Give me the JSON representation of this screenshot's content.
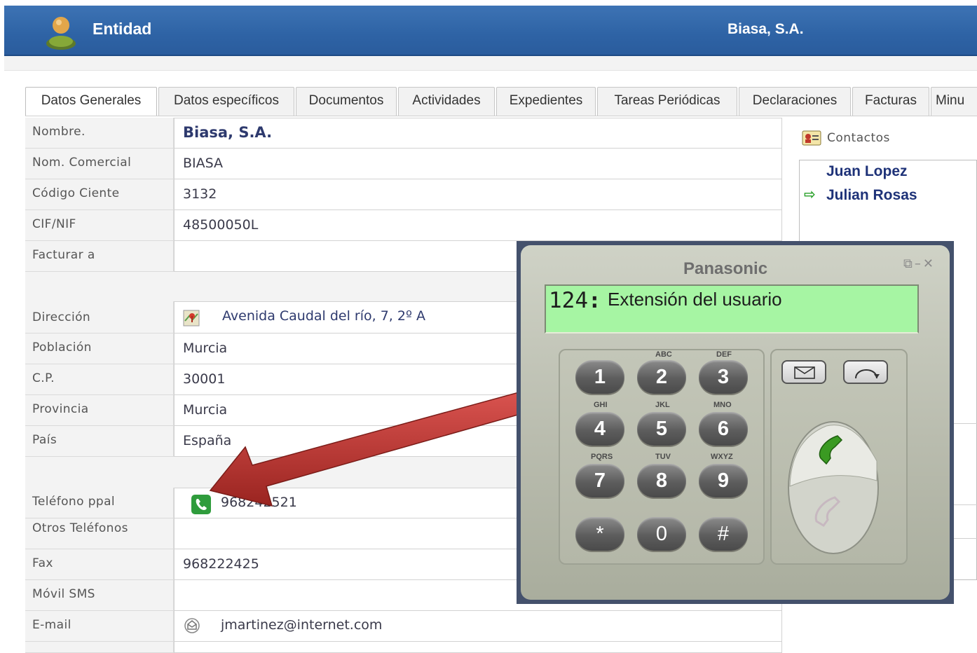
{
  "header": {
    "entity_title": "Entidad",
    "company_name": "Biasa, S.A.",
    "icon": "user-icon"
  },
  "tabs": [
    {
      "label": "Datos Generales",
      "active": true
    },
    {
      "label": "Datos específicos",
      "active": false
    },
    {
      "label": "Documentos",
      "active": false
    },
    {
      "label": "Actividades",
      "active": false
    },
    {
      "label": "Expedientes",
      "active": false
    },
    {
      "label": "Tareas Periódicas",
      "active": false
    },
    {
      "label": "Declaraciones",
      "active": false
    },
    {
      "label": "Facturas",
      "active": false
    },
    {
      "label": "Minu",
      "active": false
    }
  ],
  "form": {
    "nombre": {
      "label": "Nombre.",
      "value": "Biasa, S.A."
    },
    "nom_comercial": {
      "label": "Nom. Comercial",
      "value": "BIASA"
    },
    "codigo_cliente": {
      "label": "Código Ciente",
      "value": "3132"
    },
    "cif_nif": {
      "label": "CIF/NIF",
      "value": "48500050L"
    },
    "facturar_a": {
      "label": "Facturar a",
      "value": ""
    },
    "direccion": {
      "label": "Dirección",
      "value": "Avenida Caudal del río, 7, 2º A",
      "icon": "map-icon"
    },
    "poblacion": {
      "label": "Población",
      "value": "Murcia"
    },
    "cp": {
      "label": "C.P.",
      "value": "30001"
    },
    "provincia": {
      "label": "Provincia",
      "value": "Murcia"
    },
    "pais": {
      "label": "País",
      "value": "España"
    },
    "telefono_ppal": {
      "label": "Teléfono ppal",
      "value": "968242521",
      "icon": "phone-icon"
    },
    "otros_telefonos": {
      "label": "Otros Teléfonos",
      "value": ""
    },
    "fax": {
      "label": "Fax",
      "value": "968222425"
    },
    "movil_sms": {
      "label": "Móvil SMS",
      "value": ""
    },
    "email": {
      "label": "E-mail",
      "value": "jmartinez@internet.com",
      "icon": "email-icon"
    }
  },
  "contacts": {
    "title": "Contactos",
    "icon": "contact-card-icon",
    "items": [
      {
        "name": "Juan Lopez",
        "selected": false
      },
      {
        "name": "Julian Rosas",
        "selected": true
      }
    ]
  },
  "phone_widget": {
    "brand": "Panasonic",
    "extension": "124",
    "separator": ":",
    "display_text": "Extensión del usuario",
    "keys": [
      {
        "digit": "1",
        "letters": ""
      },
      {
        "digit": "2",
        "letters": "ABC"
      },
      {
        "digit": "3",
        "letters": "DEF"
      },
      {
        "digit": "4",
        "letters": "GHI"
      },
      {
        "digit": "5",
        "letters": "JKL"
      },
      {
        "digit": "6",
        "letters": "MNO"
      },
      {
        "digit": "7",
        "letters": "PQRS"
      },
      {
        "digit": "8",
        "letters": "TUV"
      },
      {
        "digit": "9",
        "letters": "WXYZ"
      },
      {
        "digit": "*",
        "letters": ""
      },
      {
        "digit": "0",
        "letters": ""
      },
      {
        "digit": "#",
        "letters": ""
      }
    ],
    "buttons": [
      "message-icon",
      "redial-icon",
      "call-answer-icon",
      "hang-up-icon"
    ],
    "window_buttons": [
      "restore-icon",
      "minimize-icon",
      "close-icon"
    ]
  },
  "colors": {
    "header_blue": "#2e63a5",
    "lcd_green": "#a6f5a3",
    "arrow_red": "#b32f2f",
    "link_navy": "#1e3278"
  }
}
